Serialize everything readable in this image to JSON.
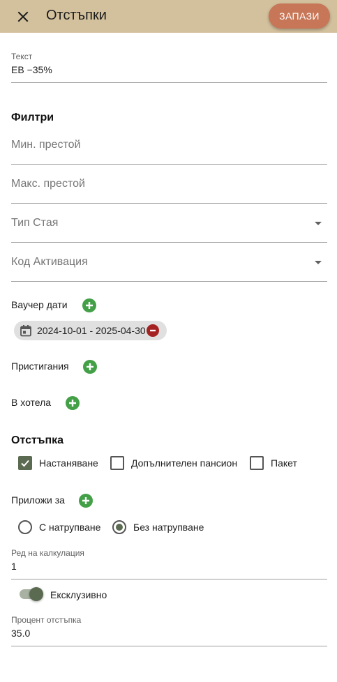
{
  "header": {
    "title": "Отстъпки",
    "save_label": "ЗАПАЗИ",
    "close_icon": "close-icon"
  },
  "text_field": {
    "label": "Текст",
    "value": "ЕВ −35%"
  },
  "filters": {
    "title": "Филтри",
    "min_stay_placeholder": "Мин. престой",
    "max_stay_placeholder": "Макс. престой",
    "room_type_placeholder": "Тип Стая",
    "activation_code_placeholder": "Код Активация"
  },
  "voucher_dates": {
    "label": "Ваучер дати",
    "chips": [
      "2024-10-01 - 2025-04-30"
    ]
  },
  "arrivals": {
    "label": "Пристигания"
  },
  "in_hotel": {
    "label": "В хотела"
  },
  "discount": {
    "title": "Отстъпка",
    "options": [
      {
        "label": "Настаняване",
        "checked": true
      },
      {
        "label": "Допълнителен пансион",
        "checked": false
      },
      {
        "label": "Пакет",
        "checked": false
      }
    ]
  },
  "apply_to": {
    "label": "Приложи за",
    "radios": [
      {
        "label": "С натрупване",
        "checked": false
      },
      {
        "label": "Без натрупване",
        "checked": true
      }
    ]
  },
  "calc_order": {
    "label": "Ред на калкулация",
    "value": "1"
  },
  "exclusive": {
    "label": "Ексклузивно",
    "on": true
  },
  "discount_percent": {
    "label": "Процент отстъпка",
    "value": "35.0"
  },
  "colors": {
    "header_bg": "#d3c19d",
    "save_button": "#c77657",
    "add_green": "#43a047",
    "remove_red": "#a52222",
    "accent": "#5b6b52"
  }
}
